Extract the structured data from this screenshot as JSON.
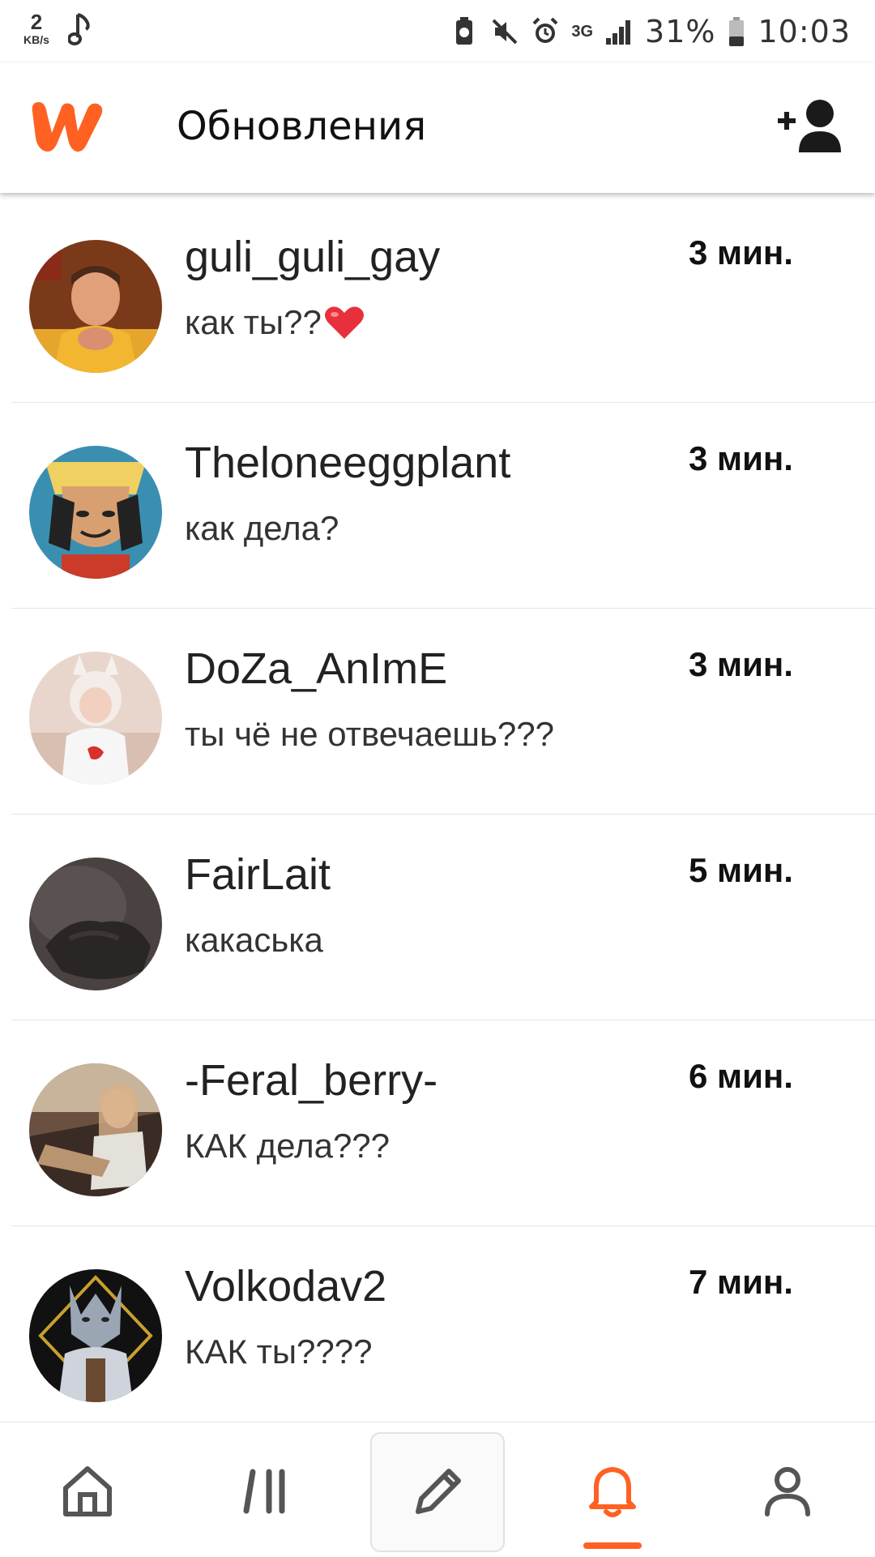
{
  "status_bar": {
    "speed_value": "2",
    "speed_unit": "KB/s",
    "network": "3G",
    "battery": "31%",
    "time": "10:03",
    "icons": [
      "music-note-icon",
      "clean-icon",
      "mute-icon",
      "alarm-icon",
      "signal-icon",
      "battery-icon"
    ]
  },
  "header": {
    "title": "Обновления",
    "logo": "wattpad-logo",
    "action_icon": "add-friend-icon"
  },
  "messages": [
    {
      "user": "guli_guli_gay",
      "text": "как ты??",
      "emoji": "heart",
      "time": "3 мин."
    },
    {
      "user": "Theloneeggplant",
      "text": "как дела?",
      "time": "3 мин."
    },
    {
      "user": "DoZa_AnImE",
      "text": "ты чё не отвечаешь???",
      "time": "3 мин."
    },
    {
      "user": "FairLait",
      "text": "какаська",
      "time": "5 мин."
    },
    {
      "user": "-Feral_berry-",
      "text": "КАК дела???",
      "time": "6 мин."
    },
    {
      "user": "Volkodav2",
      "text": "КАК ты????",
      "time": "7 мин."
    }
  ],
  "bottom_nav": {
    "items": [
      "home-icon",
      "library-icon",
      "write-icon",
      "notifications-icon",
      "profile-icon"
    ],
    "active": "notifications-icon"
  },
  "colors": {
    "accent": "#ff6122",
    "text": "#222222",
    "heart": "#e8303c"
  }
}
